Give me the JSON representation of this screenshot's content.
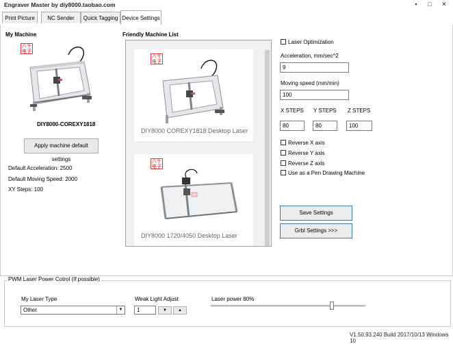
{
  "window": {
    "title": "Engraver Master by diy8000.taobao.com",
    "controls": {
      "minimize": "▪",
      "maximize": "□",
      "close": "✕"
    }
  },
  "tabs": [
    {
      "label": "Print Picture"
    },
    {
      "label": "NC Sender"
    },
    {
      "label": "Quick Tagging"
    },
    {
      "label": "Device Settings",
      "active": true
    }
  ],
  "my_machine": {
    "heading": "My Machine",
    "logo_text": "八千电子",
    "machine_name": "DIY8000-COREXY1818",
    "apply_button": "Apply machine default settings",
    "default_acceleration": "Default Acceleration: 2500",
    "default_moving_speed": "Default Moving Speed: 2000",
    "xy_steps": "XY Steps: 100"
  },
  "friendly_list": {
    "heading": "Friendly Machine List",
    "items": [
      {
        "caption": "DIY8000 COREXY1818 Desktop Laser",
        "logo_text": "八千电子"
      },
      {
        "caption": "DIY8000 1720/4050 Desktop Laser",
        "logo_text": "八千电子"
      }
    ]
  },
  "settings": {
    "laser_optimization": {
      "label": "Laser Optimization",
      "checked": false
    },
    "acceleration": {
      "label": "Acceleration, mm/sec^2",
      "value": "9"
    },
    "moving_speed": {
      "label": "Moving speed  (mm/min)",
      "value": "100"
    },
    "x_steps": {
      "label": "X STEPS",
      "value": "80"
    },
    "y_steps": {
      "label": "Y STEPS",
      "value": "80"
    },
    "z_steps": {
      "label": "Z STEPS",
      "value": "100"
    },
    "reverse_x": {
      "label": "Reverse X axis",
      "checked": false
    },
    "reverse_y": {
      "label": "Reverse Y axis",
      "checked": false
    },
    "reverse_z": {
      "label": "Reverse Z axis",
      "checked": false
    },
    "pen_drawing": {
      "label": "Use as a Pen Drawing Machine",
      "checked": false
    },
    "save_button": "Save Settings",
    "grbl_button": "Grbl Settings >>>"
  },
  "pwm": {
    "group_title": "PWM Laser Power Cotrol (If possible)",
    "laser_type_label": "My Laser Type",
    "laser_type_value": "Other",
    "weak_light_label": "Weak Light Adjust",
    "weak_light_value": "1",
    "laser_power_label": "Laser power 80%",
    "laser_power_percent": 80
  },
  "status": "V1.50.93.240 Build 2017/10/13 Windows 10"
}
